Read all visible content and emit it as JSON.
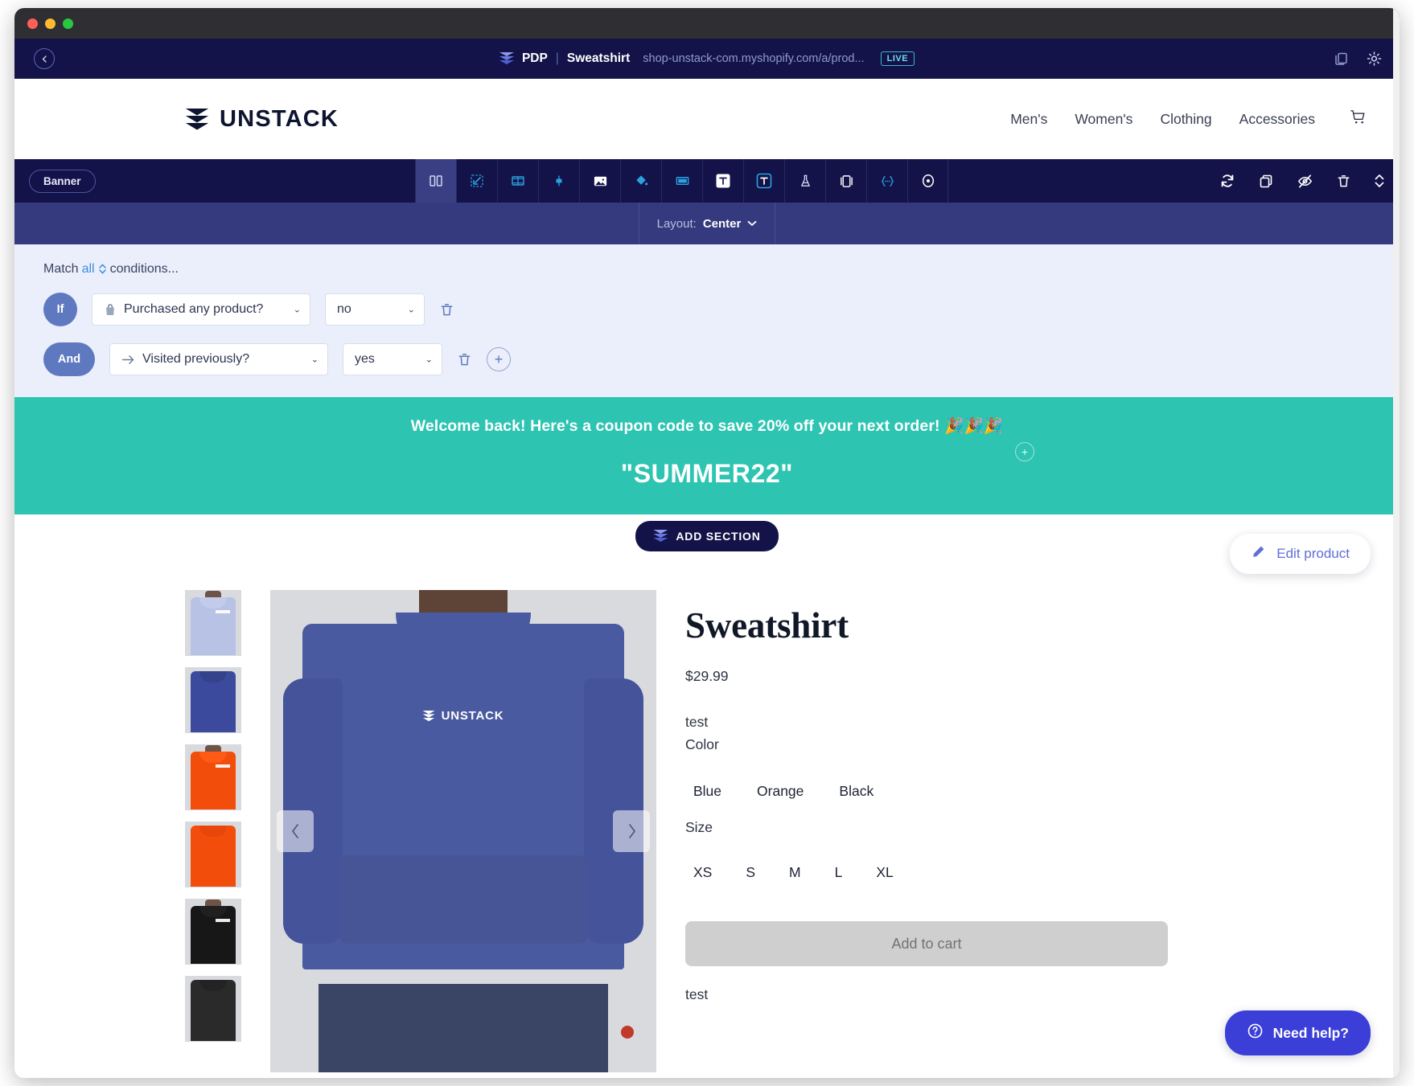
{
  "window": {
    "traffic_lights": [
      "close",
      "minimize",
      "zoom"
    ]
  },
  "editor_bar": {
    "back_icon": "chevron-left-icon",
    "logo_icon": "unstack-stack-icon",
    "page_type": "PDP",
    "separator": "|",
    "page_name": "Sweatshirt",
    "url": "shop-unstack-com.myshopify.com/a/prod...",
    "status_badge": "LIVE",
    "right_icons": [
      "copy-icon",
      "gear-icon"
    ]
  },
  "site_header": {
    "brand": "UNSTACK",
    "nav": [
      "Men's",
      "Women's",
      "Clothing",
      "Accessories"
    ],
    "cart_icon": "shopping-cart-icon"
  },
  "section_toolbar": {
    "section_chip": "Banner",
    "tools": [
      {
        "name": "columns-icon",
        "active": true
      },
      {
        "name": "section-resize-icon",
        "active": false
      },
      {
        "name": "filmstrip-icon",
        "active": false
      },
      {
        "name": "align-icon",
        "active": false
      },
      {
        "name": "image-icon",
        "active": false
      },
      {
        "name": "paint-bucket-icon",
        "active": false
      },
      {
        "name": "background-icon",
        "active": false
      },
      {
        "name": "text-light-icon",
        "active": false
      },
      {
        "name": "text-dark-icon",
        "active": false
      },
      {
        "name": "flask-icon",
        "active": false
      },
      {
        "name": "slides-icon",
        "active": false
      },
      {
        "name": "code-braces-icon",
        "active": false
      },
      {
        "name": "target-icon",
        "active": false
      }
    ],
    "right_tools": [
      "refresh-icon",
      "duplicate-icon",
      "hide-eye-icon",
      "trash-icon",
      "reorder-updown-icon"
    ]
  },
  "layout_row": {
    "label": "Layout:",
    "value": "Center",
    "caret": "chevron-down-icon"
  },
  "conditions": {
    "match_prefix": "Match",
    "match_value": "all",
    "match_suffix": "conditions...",
    "rows": [
      {
        "tag": "If",
        "field_icon": "shopping-bag-icon",
        "field": "Purchased any product?",
        "value": "no",
        "delete_icon": "trash-icon"
      },
      {
        "tag": "And",
        "field_icon": "arrow-right-icon",
        "field": "Visited previously?",
        "value": "yes",
        "delete_icon": "trash-icon",
        "add_icon": "plus-icon"
      }
    ]
  },
  "banner": {
    "message": "Welcome back! Here's a coupon code to save 20% off your next order! 🎉🎉🎉",
    "coupon_code": "\"SUMMER22\"",
    "add_block_icon": "plus-icon",
    "background_color": "#2ec4b2"
  },
  "add_section": {
    "label": "ADD SECTION",
    "icon": "unstack-stack-icon"
  },
  "edit_product": {
    "label": "Edit product",
    "icon": "pencil-icon"
  },
  "product": {
    "title": "Sweatshirt",
    "price": "$29.99",
    "note_top": "test",
    "color_label": "Color",
    "colors": [
      "Blue",
      "Orange",
      "Black"
    ],
    "size_label": "Size",
    "sizes": [
      "XS",
      "S",
      "M",
      "L",
      "XL"
    ],
    "add_to_cart": "Add to cart",
    "note_bottom": "test",
    "prev_arrow": "chevron-left-icon",
    "next_arrow": "chevron-right-icon",
    "hero_logo_text": "UNSTACK",
    "thumbnails": [
      {
        "name": "thumb-light-blue-front",
        "color": "#b7c2e4"
      },
      {
        "name": "thumb-blue-back",
        "color": "#3b4a9c"
      },
      {
        "name": "thumb-orange-front",
        "color": "#f34d0c"
      },
      {
        "name": "thumb-orange-back",
        "color": "#f34d0c"
      },
      {
        "name": "thumb-black-front",
        "color": "#171717"
      },
      {
        "name": "thumb-black-back",
        "color": "#2a2a2a"
      }
    ]
  },
  "need_help": {
    "label": "Need help?",
    "icon": "question-circle-icon"
  }
}
